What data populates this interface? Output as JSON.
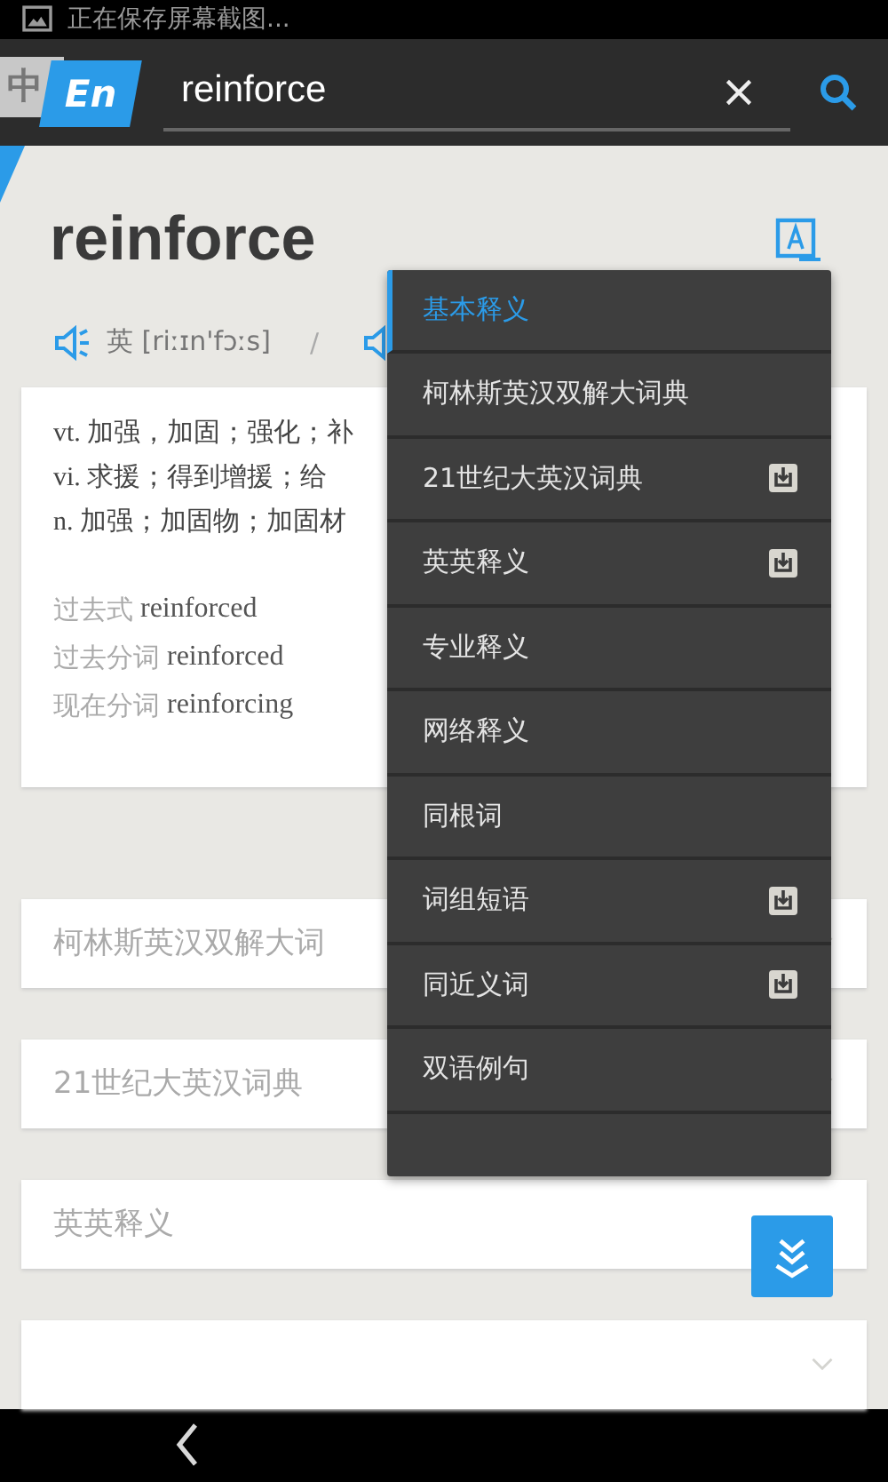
{
  "status_bar": {
    "notification": "正在保存屏幕截图..."
  },
  "toolbar": {
    "lang_tabs": [
      {
        "label": "中",
        "selected": false
      },
      {
        "label": "En",
        "selected": true
      }
    ],
    "search": {
      "value": "reinforce"
    }
  },
  "word": {
    "headword": "reinforce",
    "pronunciations": [
      {
        "text": "英 [riːɪn'fɔːs]"
      }
    ],
    "separator": "/"
  },
  "definitions": [
    {
      "text": "vt. 加强，加固；强化；补"
    },
    {
      "text": "vi. 求援；得到增援；给"
    },
    {
      "text": "n. 加强；加固物；加固材"
    }
  ],
  "forms": [
    {
      "label": "过去式",
      "value": "reinforced"
    },
    {
      "label": "过去分词",
      "value": "reinforced"
    },
    {
      "label": "现在分词",
      "value": "reinforcing"
    }
  ],
  "sections": [
    {
      "title": "柯林斯英汉双解大词"
    },
    {
      "title": "21世纪大英汉词典"
    },
    {
      "title": "英英释义"
    }
  ],
  "menu": [
    {
      "label": "基本释义",
      "selected": true,
      "download": false
    },
    {
      "label": "柯林斯英汉双解大词典",
      "selected": false,
      "download": false
    },
    {
      "label": "21世纪大英汉词典",
      "selected": false,
      "download": true
    },
    {
      "label": "英英释义",
      "selected": false,
      "download": true
    },
    {
      "label": "专业释义",
      "selected": false,
      "download": false
    },
    {
      "label": "网络释义",
      "selected": false,
      "download": false
    },
    {
      "label": "同根词",
      "selected": false,
      "download": false
    },
    {
      "label": "词组短语",
      "selected": false,
      "download": true
    },
    {
      "label": "同近义词",
      "selected": false,
      "download": true
    },
    {
      "label": "双语例句",
      "selected": false,
      "download": false
    }
  ]
}
